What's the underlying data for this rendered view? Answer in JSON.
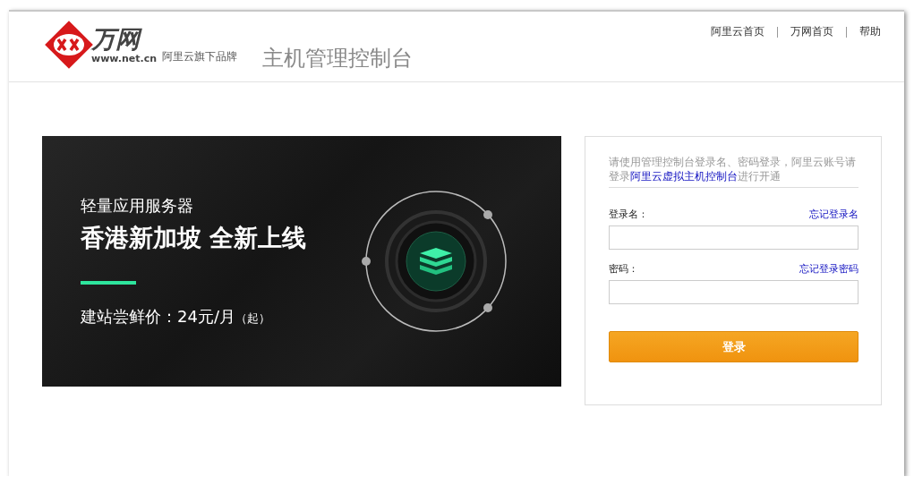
{
  "header": {
    "logo": {
      "name": "万网",
      "url": "www.net.cn"
    },
    "brand_note": "阿里云旗下品牌",
    "title": "主机管理控制台",
    "nav": [
      "阿里云首页",
      "万网首页",
      "帮助"
    ]
  },
  "banner": {
    "subtitle": "轻量应用服务器",
    "headline": "香港新加坡 全新上线",
    "price": "建站尝鲜价：24元/月",
    "price_note": "（起）"
  },
  "login": {
    "notice": "请使用管理控制台登录名、密码登录，阿里云账号请登录",
    "notice_link": "阿里云虚拟主机控制台",
    "notice_tail": "进行开通",
    "fields": [
      {
        "label": "登录名：",
        "link": "忘记登录名"
      },
      {
        "label": "密码：",
        "link": "忘记登录密码"
      }
    ],
    "submit": "登录"
  }
}
